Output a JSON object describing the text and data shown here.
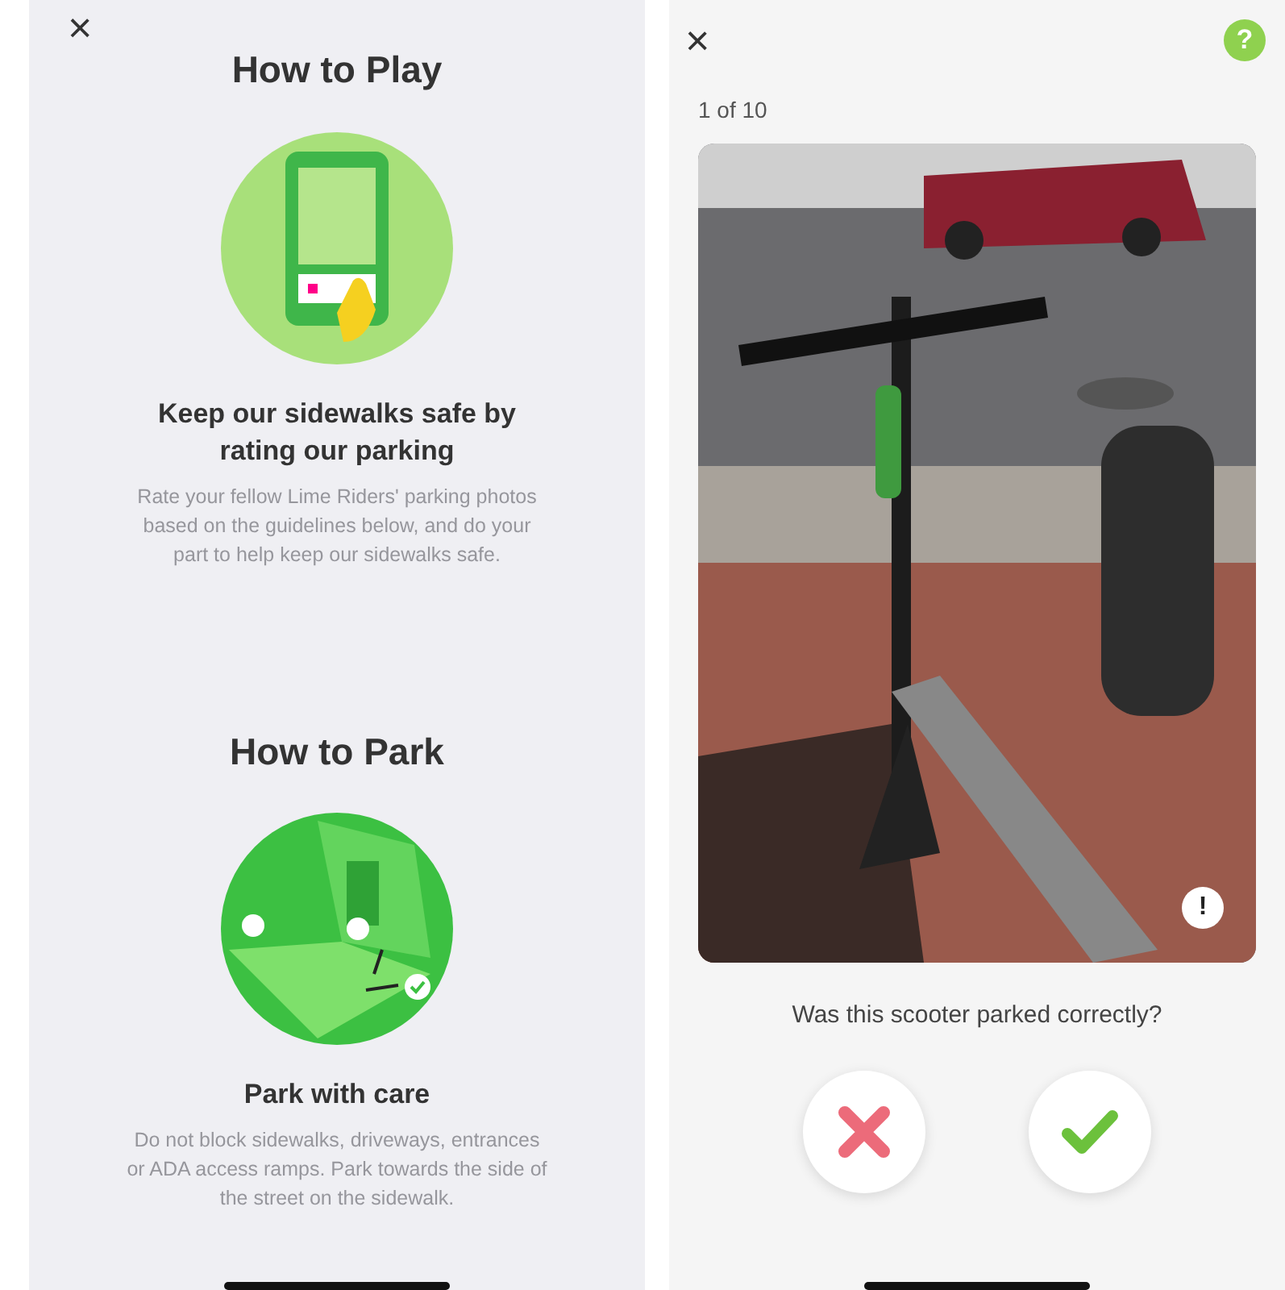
{
  "guide_screen": {
    "close": "×",
    "sections": [
      {
        "title": "How to Play",
        "kind": "phone",
        "heading": "Keep our sidewalks safe by rating our parking",
        "body": "Rate your fellow Lime Riders' parking photos based on the guidelines below, and do your part to help keep our sidewalks safe."
      },
      {
        "title": "How to Park",
        "kind": "street",
        "heading": "Park with care",
        "body": "Do not block sidewalks, driveways, entrances or ADA access ramps.  Park towards the side of the street on the sidewalk."
      }
    ]
  },
  "rating_screen": {
    "close": "×",
    "help": "?",
    "counter": "1 of 10",
    "report": "!",
    "question": "Was this scooter parked correctly?",
    "answers": [
      {
        "kind": "no"
      },
      {
        "kind": "yes"
      }
    ]
  }
}
